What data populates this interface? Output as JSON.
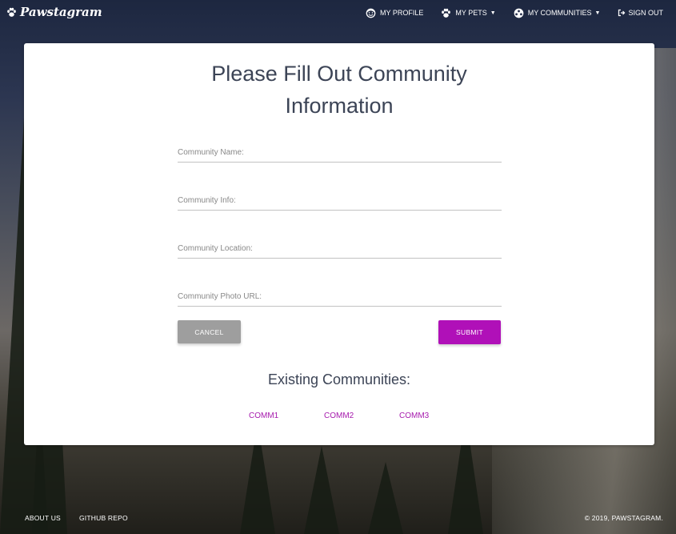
{
  "navbar": {
    "brand": "Pawstagram",
    "brand_icon": "paw-icon",
    "items": [
      {
        "label": "MY PROFILE",
        "icon": "face-icon",
        "dropdown": false
      },
      {
        "label": "MY PETS",
        "icon": "paw-icon",
        "dropdown": true
      },
      {
        "label": "MY COMMUNITIES",
        "icon": "community-icon",
        "dropdown": true
      },
      {
        "label": "SIGN OUT",
        "icon": "sign-out-icon",
        "dropdown": false
      }
    ]
  },
  "form": {
    "title_line1": "Please Fill Out Community",
    "title_line2": "Information",
    "fields": [
      {
        "placeholder": "Community Name:",
        "value": ""
      },
      {
        "placeholder": "Community Info:",
        "value": ""
      },
      {
        "placeholder": "Community Location:",
        "value": ""
      },
      {
        "placeholder": "Community Photo URL:",
        "value": ""
      }
    ],
    "cancel_label": "CANCEL",
    "submit_label": "SUBMIT"
  },
  "existing": {
    "heading": "Existing Communities:",
    "communities": [
      "COMM1",
      "COMM2",
      "COMM3"
    ]
  },
  "footer": {
    "links": [
      "ABOUT US",
      "GITHUB REPO"
    ],
    "copyright": "© 2019, PAWSTAGRAM."
  },
  "colors": {
    "accent": "#b010b8",
    "link": "#a61aad",
    "cancel": "#9e9e9e",
    "title": "#3c4456"
  }
}
